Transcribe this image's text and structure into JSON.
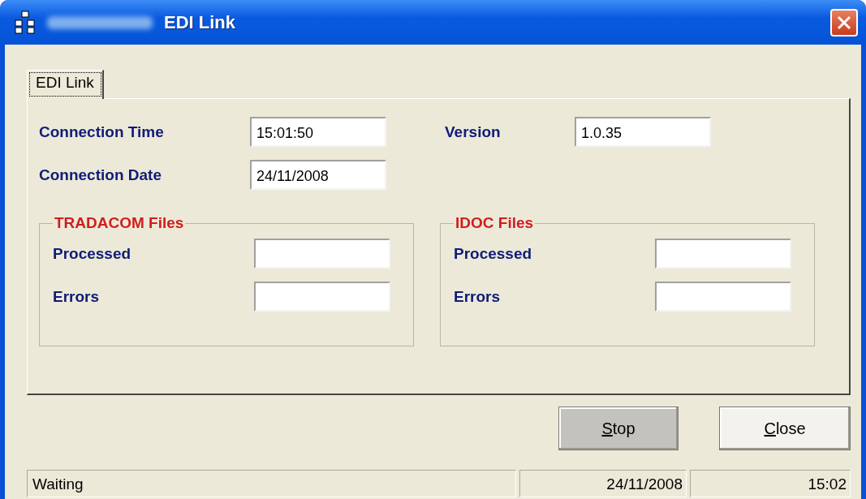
{
  "window": {
    "title": "EDI Link"
  },
  "tabs": [
    {
      "label": "EDI Link",
      "selected": true
    }
  ],
  "fields": [
    {
      "label": "Connection Time",
      "value": "15:01:50"
    },
    {
      "label": "Version",
      "value": "1.0.35"
    },
    {
      "label": "Connection Date",
      "value": "24/11/2008"
    }
  ],
  "groups": [
    {
      "title": "TRADACOM Files",
      "fields": [
        {
          "label": "Processed"
        },
        {
          "label": "Errors"
        }
      ]
    },
    {
      "title": "IDOC Files",
      "fields": [
        {
          "label": "Processed"
        },
        {
          "label": "Errors"
        }
      ]
    }
  ],
  "buttons": [
    {
      "access_key": "S",
      "rest": "top",
      "pressed": true
    },
    {
      "access_key": "C",
      "rest": "lose",
      "pressed": false
    }
  ],
  "status_bar": [
    "Waiting",
    "24/11/2008",
    "15:02"
  ]
}
